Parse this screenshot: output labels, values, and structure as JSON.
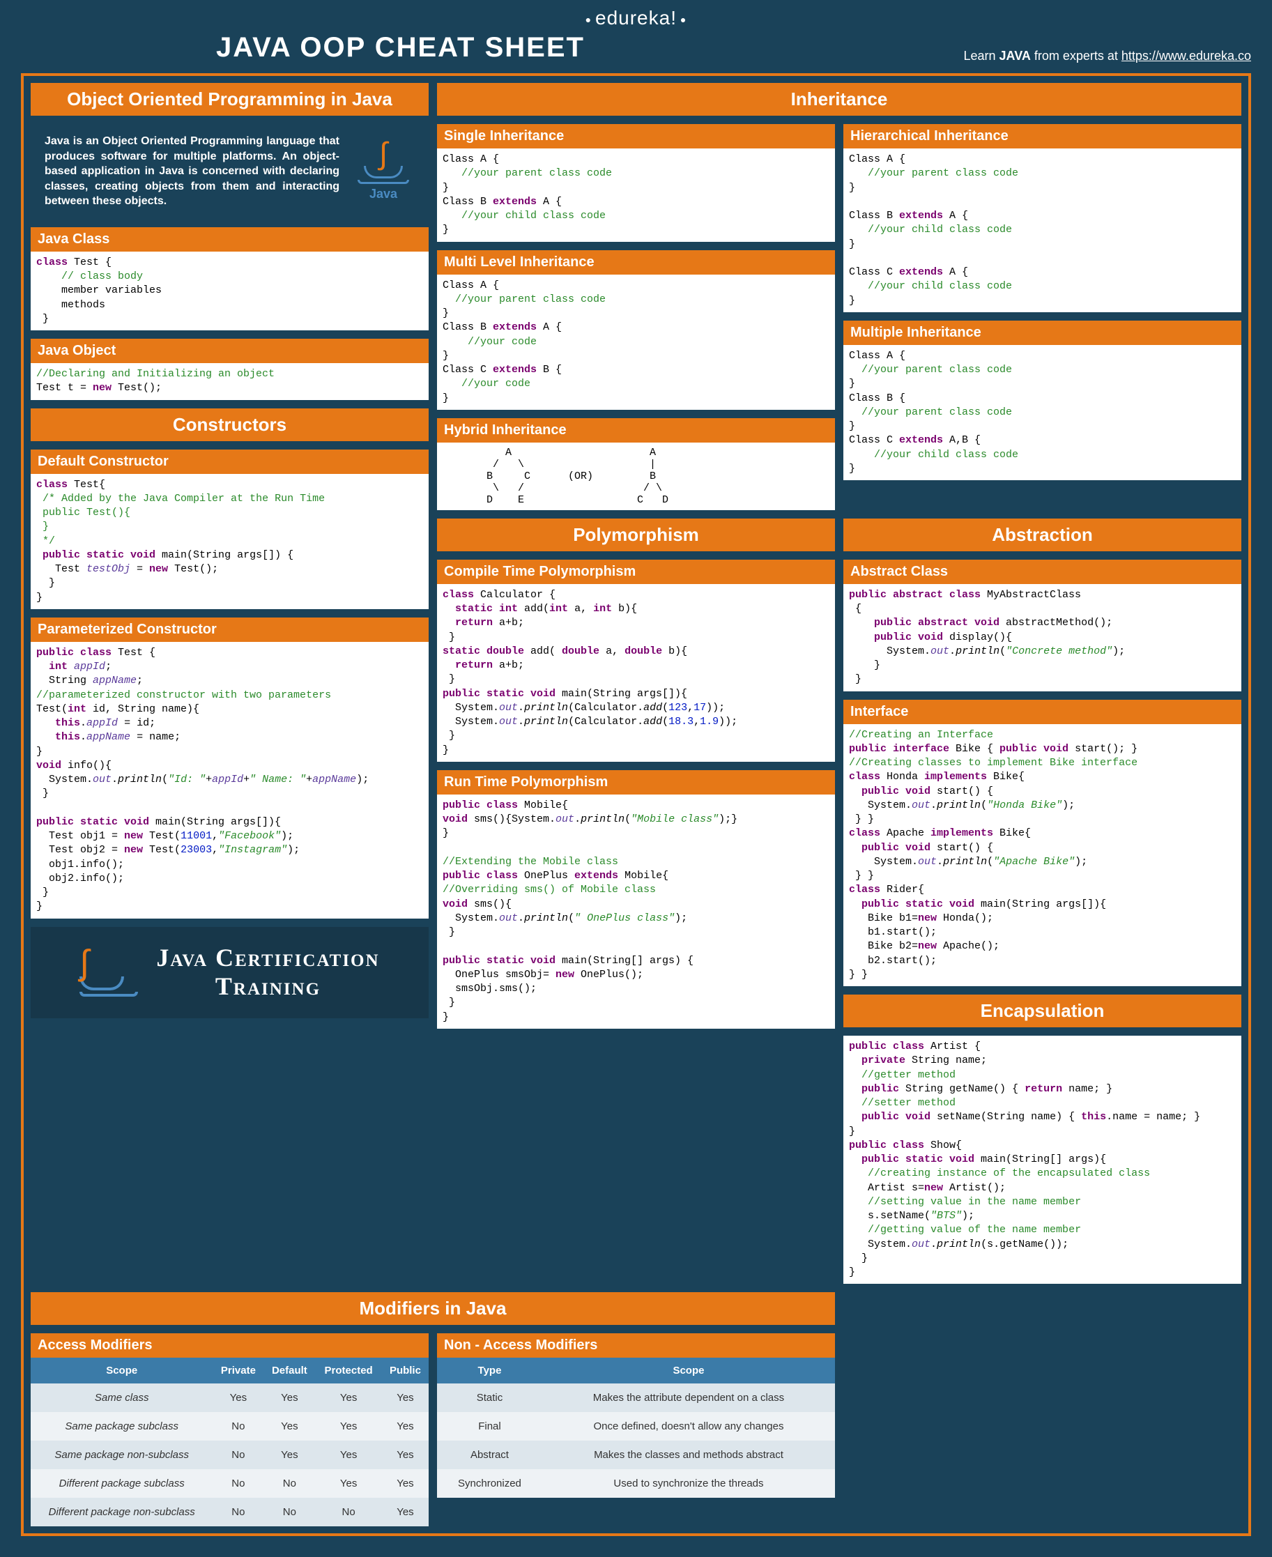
{
  "brand": "edureka!",
  "title": "JAVA OOP CHEAT SHEET",
  "learn_prefix": "Learn ",
  "learn_strong": "JAVA",
  "learn_suffix": " from experts at ",
  "learn_url": "https://www.edureka.co",
  "oop_title": "Object Oriented Programming in Java",
  "intro": "Java is an Object Oriented Programming language that produces software for multiple platforms. An object-based application in Java is concerned with declaring classes, creating objects from them and interacting between these objects.",
  "java_logo_label": "Java",
  "java_class_title": "Java Class",
  "java_object_title": "Java Object",
  "constructors_title": "Constructors",
  "default_ctor_title": "Default Constructor",
  "param_ctor_title": "Parameterized Constructor",
  "cert_text": "Java Certification Training",
  "inheritance_title": "Inheritance",
  "single_inh_title": "Single Inheritance",
  "multi_level_title": "Multi Level Inheritance",
  "hybrid_title": "Hybrid Inheritance",
  "hierarchical_title": "Hierarchical Inheritance",
  "multiple_inh_title": "Multiple Inheritance",
  "poly_title": "Polymorphism",
  "compile_poly_title": "Compile Time Polymorphism",
  "runtime_poly_title": "Run Time Polymorphism",
  "abstraction_title": "Abstraction",
  "abstract_class_title": "Abstract Class",
  "interface_title": "Interface",
  "encapsulation_title": "Encapsulation",
  "modifiers_title": "Modifiers in Java",
  "access_mod_title": "Access Modifiers",
  "nonaccess_mod_title": "Non - Access Modifiers",
  "access_headers": [
    "Scope",
    "Private",
    "Default",
    "Protected",
    "Public"
  ],
  "access_rows": [
    [
      "Same class",
      "Yes",
      "Yes",
      "Yes",
      "Yes"
    ],
    [
      "Same package subclass",
      "No",
      "Yes",
      "Yes",
      "Yes"
    ],
    [
      "Same package non-subclass",
      "No",
      "Yes",
      "Yes",
      "Yes"
    ],
    [
      "Different package subclass",
      "No",
      "No",
      "Yes",
      "Yes"
    ],
    [
      "Different package non-subclass",
      "No",
      "No",
      "No",
      "Yes"
    ]
  ],
  "nonaccess_headers": [
    "Type",
    "Scope"
  ],
  "nonaccess_rows": [
    [
      "Static",
      "Makes the attribute dependent on a class"
    ],
    [
      "Final",
      "Once defined, doesn't allow any changes"
    ],
    [
      "Abstract",
      "Makes the classes and methods abstract"
    ],
    [
      "Synchronized",
      "Used to synchronize the threads"
    ]
  ],
  "hybrid_diagram": "          A                      A\n        /   \\                    |\n       B     C      (OR)         B\n        \\   /                   / \\\n       D    E                  C   D",
  "code": {
    "java_class": "class Test {\n    // class body\n    member variables\n    methods\n }",
    "java_object": "//Declaring and Initializing an object\nTest t = new Test();",
    "default_ctor": "class Test{\n /* Added by the Java Compiler at the Run Time\n public Test(){\n }\n */\n public static void main(String args[]) {\n   Test testObj = new Test();\n  }\n}",
    "param_ctor": "public class Test {\n  int appId;\n  String appName;\n//parameterized constructor with two parameters\nTest(int id, String name){\n   this.appId = id;\n   this.appName = name;\n}\nvoid info(){\n  System.out.println(\"Id: \"+appId+\" Name: \"+appName);\n }\n\npublic static void main(String args[]){\n  Test obj1 = new Test(11001,\"Facebook\");\n  Test obj2 = new Test(23003,\"Instagram\");\n  obj1.info();\n  obj2.info();\n }\n}",
    "single_inh": "Class A {\n   //your parent class code\n}\nClass B extends A {\n   //your child class code\n}",
    "multi_level": "Class A {\n  //your parent class code\n}\nClass B extends A {\n    //your code\n}\nClass C extends B {\n   //your code\n}",
    "hierarchical": "Class A {\n   //your parent class code\n}\n\nClass B extends A {\n   //your child class code\n}\n\nClass C extends A {\n   //your child class code\n}",
    "multiple_inh": "Class A {\n  //your parent class code\n}\nClass B {\n  //your parent class code\n}\nClass C extends A,B {\n    //your child class code\n}",
    "compile_poly": "class Calculator {\n  static int add(int a, int b){\n  return a+b;\n }\nstatic double add( double a, double b){\n  return a+b;\n }\npublic static void main(String args[]){\n  System.out.println(Calculator.add(123,17));\n  System.out.println(Calculator.add(18.3,1.9));\n }\n}",
    "runtime_poly": "public class Mobile{\nvoid sms(){System.out.println(\"Mobile class\");}\n}\n\n//Extending the Mobile class\npublic class OnePlus extends Mobile{\n//Overriding sms() of Mobile class\nvoid sms(){\n  System.out.println(\" OnePlus class\");\n }\n\npublic static void main(String[] args) {\n  OnePlus smsObj= new OnePlus();\n  smsObj.sms();\n }\n}",
    "abstract_class": "public abstract class MyAbstractClass\n {\n    public abstract void abstractMethod();\n    public void display(){\n      System.out.println(\"Concrete method\");\n    }\n }",
    "interface": "//Creating an Interface\npublic interface Bike { public void start(); }\n//Creating classes to implement Bike interface\nclass Honda implements Bike{\n  public void start() {\n   System.out.println(\"Honda Bike\");\n } }\nclass Apache implements Bike{\n  public void start() {\n    System.out.println(\"Apache Bike\");\n } }\nclass Rider{\n  public static void main(String args[]){\n   Bike b1=new Honda();\n   b1.start();\n   Bike b2=new Apache();\n   b2.start();\n} }",
    "encapsulation": "public class Artist {\n  private String name;\n  //getter method\n  public String getName() { return name; }\n  //setter method\n  public void setName(String name) { this.name = name; }\n}\npublic class Show{\n  public static void main(String[] args){\n   //creating instance of the encapsulated class\n   Artist s=new Artist();\n   //setting value in the name member\n   s.setName(\"BTS\");\n   //getting value of the name member\n   System.out.println(s.getName());\n  }\n}"
  }
}
